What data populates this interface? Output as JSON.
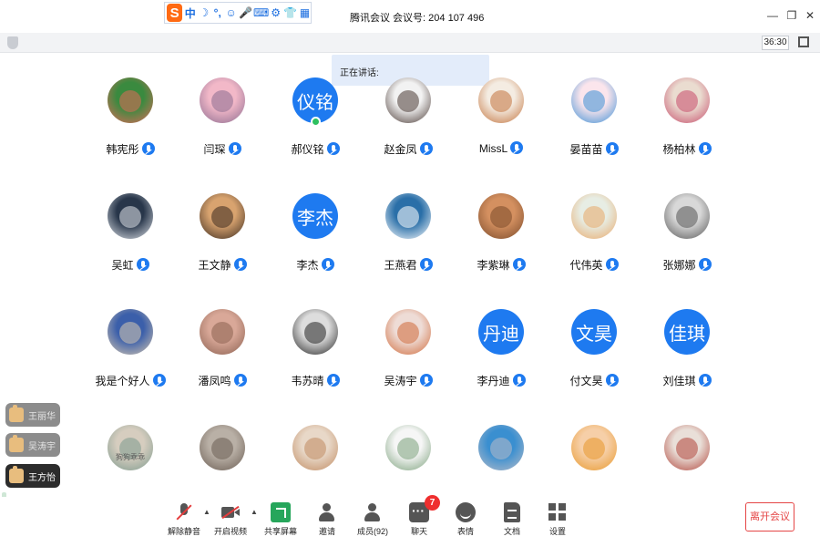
{
  "titlebar": {
    "ime_logo": "S",
    "ime_items": [
      "中",
      "☽",
      "°,",
      "☺",
      "🎤",
      "⌨",
      "⚙",
      "👕",
      "▦"
    ],
    "title": "腾讯会议 会议号: 204 107 496",
    "minimize": "—",
    "restore": "❐",
    "close": "✕"
  },
  "subbar": {
    "timer": "36:30"
  },
  "speaking": {
    "label": "正在讲话:"
  },
  "participants": [
    {
      "name": "韩宪彤",
      "avatar_type": "image",
      "colors": [
        "#3a8a3f",
        "#e06a5a"
      ]
    },
    {
      "name": "闫琛",
      "avatar_type": "image",
      "colors": [
        "#f2b8c8",
        "#8a6b8f"
      ]
    },
    {
      "name": "郝仪铭",
      "avatar_type": "text",
      "avatar_text": "仪铭"
    },
    {
      "name": "赵金凤",
      "avatar_type": "image",
      "colors": [
        "#f2f2f2",
        "#4a3a35"
      ]
    },
    {
      "name": "MissL",
      "avatar_type": "image",
      "colors": [
        "#f4ece2",
        "#c2723c"
      ]
    },
    {
      "name": "晏苗苗",
      "avatar_type": "image",
      "colors": [
        "#fbe5ec",
        "#3a8fd6"
      ]
    },
    {
      "name": "杨柏林",
      "avatar_type": "image",
      "colors": [
        "#eadcd0",
        "#c64b6a"
      ]
    },
    {
      "name": "吴虹",
      "avatar_type": "image",
      "colors": [
        "#28364a",
        "#e0e4ea"
      ]
    },
    {
      "name": "王文静",
      "avatar_type": "image",
      "colors": [
        "#d8a36f",
        "#3a2a1f"
      ]
    },
    {
      "name": "李杰",
      "avatar_type": "text",
      "avatar_text": "李杰"
    },
    {
      "name": "王燕君",
      "avatar_type": "image",
      "colors": [
        "#2a6fa8",
        "#ffffff"
      ]
    },
    {
      "name": "李紫琳",
      "avatar_type": "image",
      "colors": [
        "#d49060",
        "#7a4a2a"
      ]
    },
    {
      "name": "代伟英",
      "avatar_type": "image",
      "colors": [
        "#e7ede4",
        "#e8a868"
      ]
    },
    {
      "name": "张娜娜",
      "avatar_type": "image",
      "colors": [
        "#d8d8d8",
        "#555555"
      ]
    },
    {
      "name": "我是个好人",
      "avatar_type": "image",
      "colors": [
        "#3b5faa",
        "#d7c8b0"
      ]
    },
    {
      "name": "潘凤鸣",
      "avatar_type": "image",
      "colors": [
        "#d9a898",
        "#8a6050"
      ]
    },
    {
      "name": "韦苏晴",
      "avatar_type": "image",
      "colors": [
        "#dddddd",
        "#222222"
      ]
    },
    {
      "name": "吴涛宇",
      "avatar_type": "image",
      "colors": [
        "#eedcd6",
        "#d06a3a"
      ]
    },
    {
      "name": "李丹迪",
      "avatar_type": "text",
      "avatar_text": "丹迪"
    },
    {
      "name": "付文昊",
      "avatar_type": "text",
      "avatar_text": "文昊"
    },
    {
      "name": "刘佳琪",
      "avatar_type": "text",
      "avatar_text": "佳琪"
    },
    {
      "name": "",
      "avatar_type": "image",
      "avatar_caption": "狗狗乖乖",
      "colors": [
        "#d6cdbf",
        "#7d9a8e"
      ]
    },
    {
      "name": "",
      "avatar_type": "image",
      "colors": [
        "#b9b0a6",
        "#6a5c52"
      ]
    },
    {
      "name": "",
      "avatar_type": "image",
      "colors": [
        "#e8d8c8",
        "#c08a60"
      ]
    },
    {
      "name": "",
      "avatar_type": "image",
      "colors": [
        "#f6f6f6",
        "#7aa07a"
      ]
    },
    {
      "name": "",
      "avatar_type": "image",
      "colors": [
        "#3a8fd0",
        "#b8bcc8"
      ]
    },
    {
      "name": "",
      "avatar_type": "image",
      "colors": [
        "#f6cfa8",
        "#e8982a"
      ]
    },
    {
      "name": "",
      "avatar_type": "image",
      "colors": [
        "#e9dfd8",
        "#b0443a"
      ]
    }
  ],
  "reactions": [
    {
      "name": "王丽华",
      "style": "gray"
    },
    {
      "name": "吴涛宇",
      "style": "gray"
    },
    {
      "name": "王方怡",
      "style": "dark"
    }
  ],
  "toolbar": {
    "items": [
      {
        "label": "解除静音",
        "icon": "mic-muted-icon"
      },
      {
        "label": "开启视频",
        "icon": "camera-off-icon"
      },
      {
        "label": "共享屏幕",
        "icon": "share-screen-icon"
      },
      {
        "label": "邀请",
        "icon": "invite-icon"
      },
      {
        "label": "成员(92)",
        "icon": "members-icon"
      },
      {
        "label": "聊天",
        "icon": "chat-icon"
      },
      {
        "label": "表情",
        "icon": "emoji-icon"
      },
      {
        "label": "文档",
        "icon": "document-icon"
      },
      {
        "label": "设置",
        "icon": "settings-icon"
      }
    ],
    "chat_badge": "7",
    "leave_label": "离开会议"
  },
  "colors": {
    "accent": "#1e7af0",
    "leave": "#e54545",
    "speaking_bg": "#e3ecfa",
    "badge": "#ef2f2f"
  }
}
